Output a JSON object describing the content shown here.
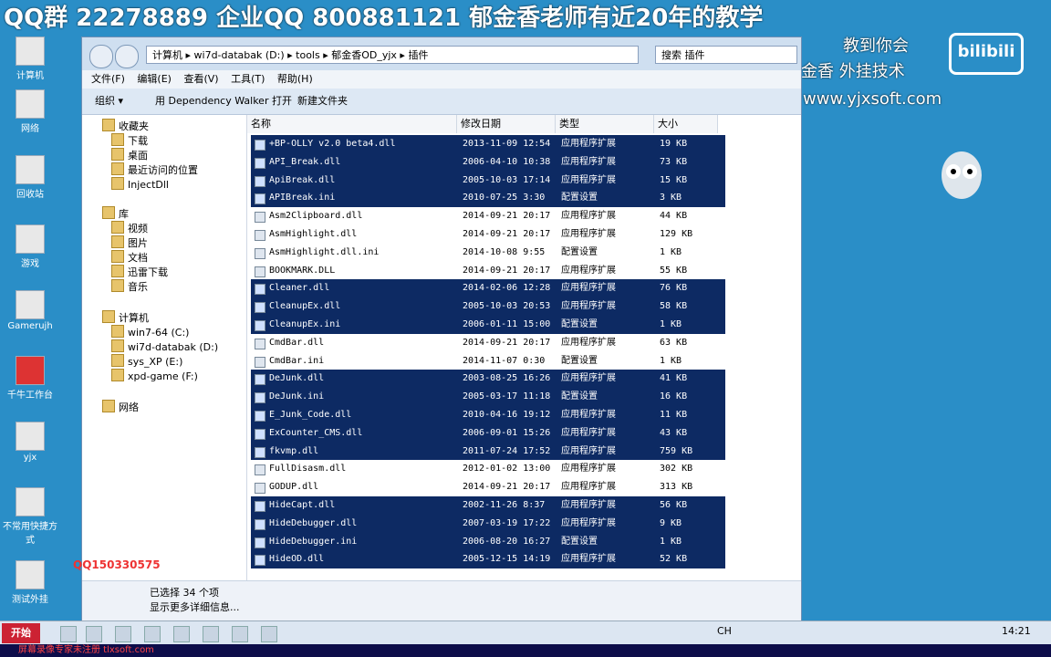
{
  "banner": {
    "text": "QQ群 22278889 企业QQ 800881121 郁金香老师有近20年的教学"
  },
  "right_overlay": {
    "line1": "教到你会",
    "line2": "金香 外挂技术",
    "line3": "www.yjxsoft.com",
    "logo": "bilibili"
  },
  "desktop_icons": [
    {
      "label": "计算机"
    },
    {
      "label": "网络"
    },
    {
      "label": "回收站"
    },
    {
      "label": "游戏"
    },
    {
      "label": "Gamerujh"
    },
    {
      "label": "千牛工作台"
    },
    {
      "label": "yjx"
    },
    {
      "label": "不常用快捷方式"
    },
    {
      "label": "测试外挂"
    }
  ],
  "window": {
    "address": "计算机 ▸ wi7d-databak (D:) ▸ tools ▸ 郁金香OD_yjx ▸ 插件",
    "search_placeholder": "搜索 插件",
    "menu": [
      "文件(F)",
      "编辑(E)",
      "查看(V)",
      "工具(T)",
      "帮助(H)"
    ],
    "toolbar": {
      "organize": "组织 ▾",
      "open_with": "用 Dependency Walker 打开",
      "new_folder": "新建文件夹"
    },
    "sidebar": {
      "favorites": "收藏夹",
      "favorites_items": [
        "下载",
        "桌面",
        "最近访问的位置",
        "InjectDll"
      ],
      "library": "库",
      "library_items": [
        "视频",
        "图片",
        "文档",
        "迅雷下载",
        "音乐"
      ],
      "computer": "计算机",
      "computer_items": [
        "win7-64 (C:)",
        "wi7d-databak (D:)",
        "sys_XP (E:)",
        "xpd-game (F:)"
      ],
      "network": "网络"
    },
    "columns": {
      "name": "名称",
      "date": "修改日期",
      "type": "类型",
      "size": "大小"
    },
    "files": [
      {
        "name": "+BP-OLLY v2.0 beta4.dll",
        "date": "2013-11-09 12:54",
        "type": "应用程序扩展",
        "size": "19 KB",
        "sel": true
      },
      {
        "name": "API_Break.dll",
        "date": "2006-04-10 10:38",
        "type": "应用程序扩展",
        "size": "73 KB",
        "sel": true
      },
      {
        "name": "ApiBreak.dll",
        "date": "2005-10-03 17:14",
        "type": "应用程序扩展",
        "size": "15 KB",
        "sel": true
      },
      {
        "name": "APIBreak.ini",
        "date": "2010-07-25 3:30",
        "type": "配置设置",
        "size": "3 KB",
        "sel": true
      },
      {
        "name": "Asm2Clipboard.dll",
        "date": "2014-09-21 20:17",
        "type": "应用程序扩展",
        "size": "44 KB",
        "sel": false
      },
      {
        "name": "AsmHighlight.dll",
        "date": "2014-09-21 20:17",
        "type": "应用程序扩展",
        "size": "129 KB",
        "sel": false
      },
      {
        "name": "AsmHighlight.dll.ini",
        "date": "2014-10-08 9:55",
        "type": "配置设置",
        "size": "1 KB",
        "sel": false
      },
      {
        "name": "BOOKMARK.DLL",
        "date": "2014-09-21 20:17",
        "type": "应用程序扩展",
        "size": "55 KB",
        "sel": false
      },
      {
        "name": "Cleaner.dll",
        "date": "2014-02-06 12:28",
        "type": "应用程序扩展",
        "size": "76 KB",
        "sel": true
      },
      {
        "name": "CleanupEx.dll",
        "date": "2005-10-03 20:53",
        "type": "应用程序扩展",
        "size": "58 KB",
        "sel": true
      },
      {
        "name": "CleanupEx.ini",
        "date": "2006-01-11 15:00",
        "type": "配置设置",
        "size": "1 KB",
        "sel": true
      },
      {
        "name": "CmdBar.dll",
        "date": "2014-09-21 20:17",
        "type": "应用程序扩展",
        "size": "63 KB",
        "sel": false
      },
      {
        "name": "CmdBar.ini",
        "date": "2014-11-07 0:30",
        "type": "配置设置",
        "size": "1 KB",
        "sel": false
      },
      {
        "name": "DeJunk.dll",
        "date": "2003-08-25 16:26",
        "type": "应用程序扩展",
        "size": "41 KB",
        "sel": true
      },
      {
        "name": "DeJunk.ini",
        "date": "2005-03-17 11:18",
        "type": "配置设置",
        "size": "16 KB",
        "sel": true
      },
      {
        "name": "E_Junk_Code.dll",
        "date": "2010-04-16 19:12",
        "type": "应用程序扩展",
        "size": "11 KB",
        "sel": true
      },
      {
        "name": "ExCounter_CMS.dll",
        "date": "2006-09-01 15:26",
        "type": "应用程序扩展",
        "size": "43 KB",
        "sel": true
      },
      {
        "name": "fkvmp.dll",
        "date": "2011-07-24 17:52",
        "type": "应用程序扩展",
        "size": "759 KB",
        "sel": true
      },
      {
        "name": "FullDisasm.dll",
        "date": "2012-01-02 13:00",
        "type": "应用程序扩展",
        "size": "302 KB",
        "sel": false
      },
      {
        "name": "GODUP.dll",
        "date": "2014-09-21 20:17",
        "type": "应用程序扩展",
        "size": "313 KB",
        "sel": false
      },
      {
        "name": "HideCapt.dll",
        "date": "2002-11-26 8:37",
        "type": "应用程序扩展",
        "size": "56 KB",
        "sel": true
      },
      {
        "name": "HideDebugger.dll",
        "date": "2007-03-19 17:22",
        "type": "应用程序扩展",
        "size": "9 KB",
        "sel": true
      },
      {
        "name": "HideDebugger.ini",
        "date": "2006-08-20 16:27",
        "type": "配置设置",
        "size": "1 KB",
        "sel": true
      },
      {
        "name": "HideOD.dll",
        "date": "2005-12-15 14:19",
        "type": "应用程序扩展",
        "size": "52 KB",
        "sel": true
      }
    ],
    "details": {
      "selected": "已选择 34 个项",
      "more": "显示更多详细信息..."
    }
  },
  "qq_float": "QQ150330575",
  "taskbar": {
    "start": "开始",
    "lang": "CH",
    "time": "14:21"
  },
  "bottom_bar": "屏幕录像专家未注册 tlxsoft.com"
}
